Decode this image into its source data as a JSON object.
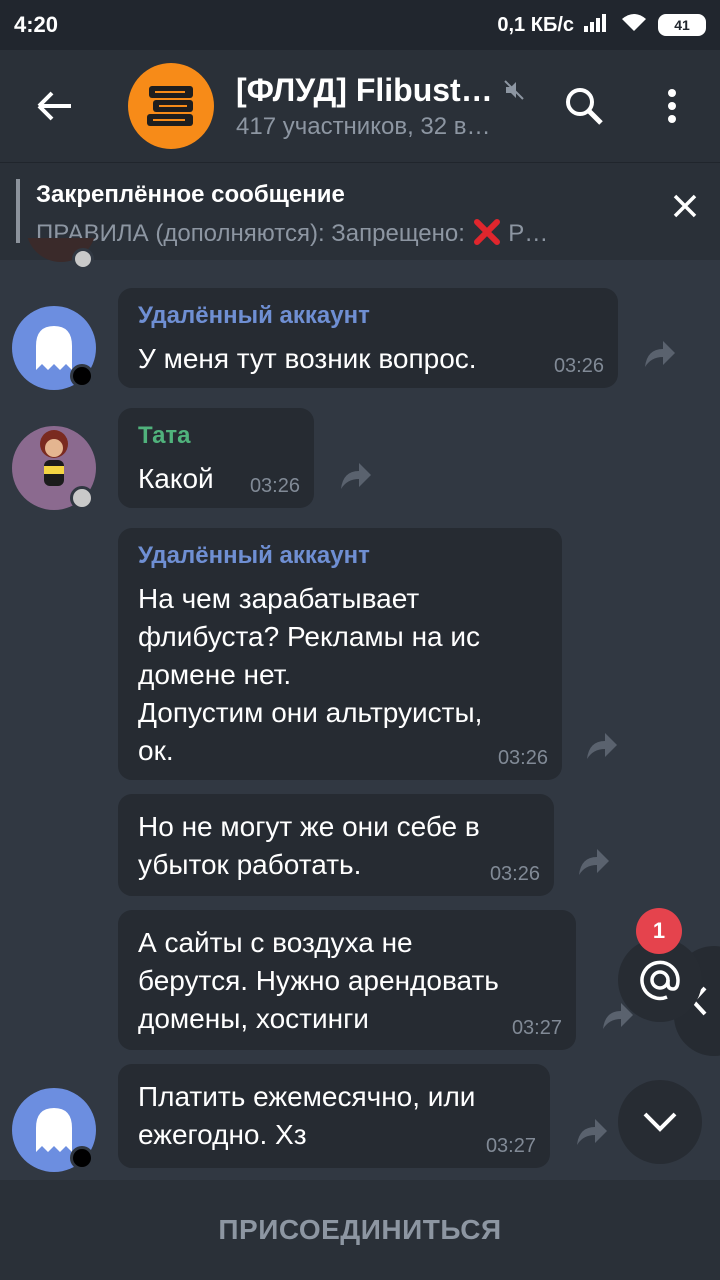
{
  "status_bar": {
    "time": "4:20",
    "net_speed": "0,1 КБ/с",
    "battery": "41"
  },
  "header": {
    "title": "[ФЛУД] Flibust…",
    "subtitle": "417 участников, 32 в…"
  },
  "pinned": {
    "title": "Закреплённое сообщение",
    "text_before": "ПРАВИЛА (дополняются):  Запрещено: ",
    "text_after": " Р…"
  },
  "messages": [
    {
      "author": "Удалённый аккаунт",
      "text": "У меня тут возник вопрос.",
      "time": "03:26"
    },
    {
      "author": "Тата",
      "text": "Какой",
      "time": "03:26"
    },
    {
      "author": "Удалённый аккаунт",
      "lines": [
        "На чем зарабатывает",
        "флибуста? Рекламы на ис",
        "домене нет.",
        "Допустим они альтруисты,",
        "ок."
      ],
      "time": "03:26"
    },
    {
      "lines": [
        "Но не могут же они себе в",
        "убыток работать."
      ],
      "time": "03:26"
    },
    {
      "lines": [
        "А сайты с воздуха не",
        "берутся. Нужно арендовать",
        "домены, хостинги"
      ],
      "time": "03:27"
    },
    {
      "lines": [
        "Платить ежемесячно, или",
        "ежегодно. Хз"
      ],
      "time": "03:27"
    }
  ],
  "mentions_badge": "1",
  "join_button": "ПРИСОЕДИНИТЬСЯ",
  "colors": {
    "background": "#313842",
    "bubble": "#262b32",
    "accent_blue": "#6f8fd3",
    "accent_green": "#50b27c",
    "badge": "#e5434d",
    "group_avatar": "#f78b18"
  }
}
